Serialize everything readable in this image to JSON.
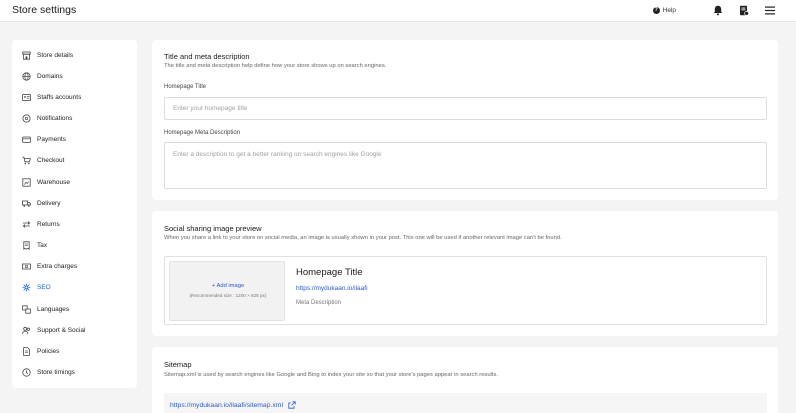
{
  "header": {
    "title": "Store settings",
    "help_label": "Help"
  },
  "sidebar": {
    "items": [
      {
        "label": "Store details",
        "icon": "storefront-icon"
      },
      {
        "label": "Domains",
        "icon": "globe-icon"
      },
      {
        "label": "Staffs accounts",
        "icon": "id-card-icon"
      },
      {
        "label": "Notifications",
        "icon": "bell-settings-icon"
      },
      {
        "label": "Payments",
        "icon": "wallet-icon"
      },
      {
        "label": "Checkout",
        "icon": "cart-icon"
      },
      {
        "label": "Warehouse",
        "icon": "warehouse-icon"
      },
      {
        "label": "Delivery",
        "icon": "truck-icon"
      },
      {
        "label": "Returns",
        "icon": "return-arrows-icon"
      },
      {
        "label": "Tax",
        "icon": "receipt-icon"
      },
      {
        "label": "Extra charges",
        "icon": "money-icon"
      },
      {
        "label": "SEO",
        "icon": "seo-icon",
        "active": true
      },
      {
        "label": "Languages",
        "icon": "translate-icon"
      },
      {
        "label": "Support & Social",
        "icon": "people-icon"
      },
      {
        "label": "Policies",
        "icon": "document-icon"
      },
      {
        "label": "Store timings",
        "icon": "clock-icon"
      }
    ],
    "active_color": "#1e5fd6"
  },
  "meta_section": {
    "title": "Title and meta description",
    "description": "The title and meta description help define how your store shows up on search engines.",
    "homepage_title_label": "Homepage Title",
    "homepage_title_placeholder": "Enter your homepage title",
    "homepage_title_value": "",
    "meta_description_label": "Homepage Meta Description",
    "meta_description_placeholder": "Enter a description to get a better ranking on search engines like Google",
    "meta_description_value": ""
  },
  "social_section": {
    "title": "Social sharing image preview",
    "description": "When you share a link to your store on social media, an image is usually shown in your post. This one will be used if another relevant image can't be found.",
    "add_image_label": "+ Add image",
    "recommended_size": "(Recommended size : 1200 × 628 px)",
    "preview_title": "Homepage Title",
    "preview_url": "https://mydukaan.io/ilaafi",
    "preview_meta": "Meta Description"
  },
  "sitemap_section": {
    "title": "Sitemap",
    "description": "Sitemap.xml is used by search engines like Google and Bing to index your site so that your store's pages appear in search results.",
    "url": "https://mydukaan.io/ilaafi/sitemap.xml"
  },
  "colors": {
    "background": "#f4f4f5",
    "link": "#2a5bc7"
  }
}
